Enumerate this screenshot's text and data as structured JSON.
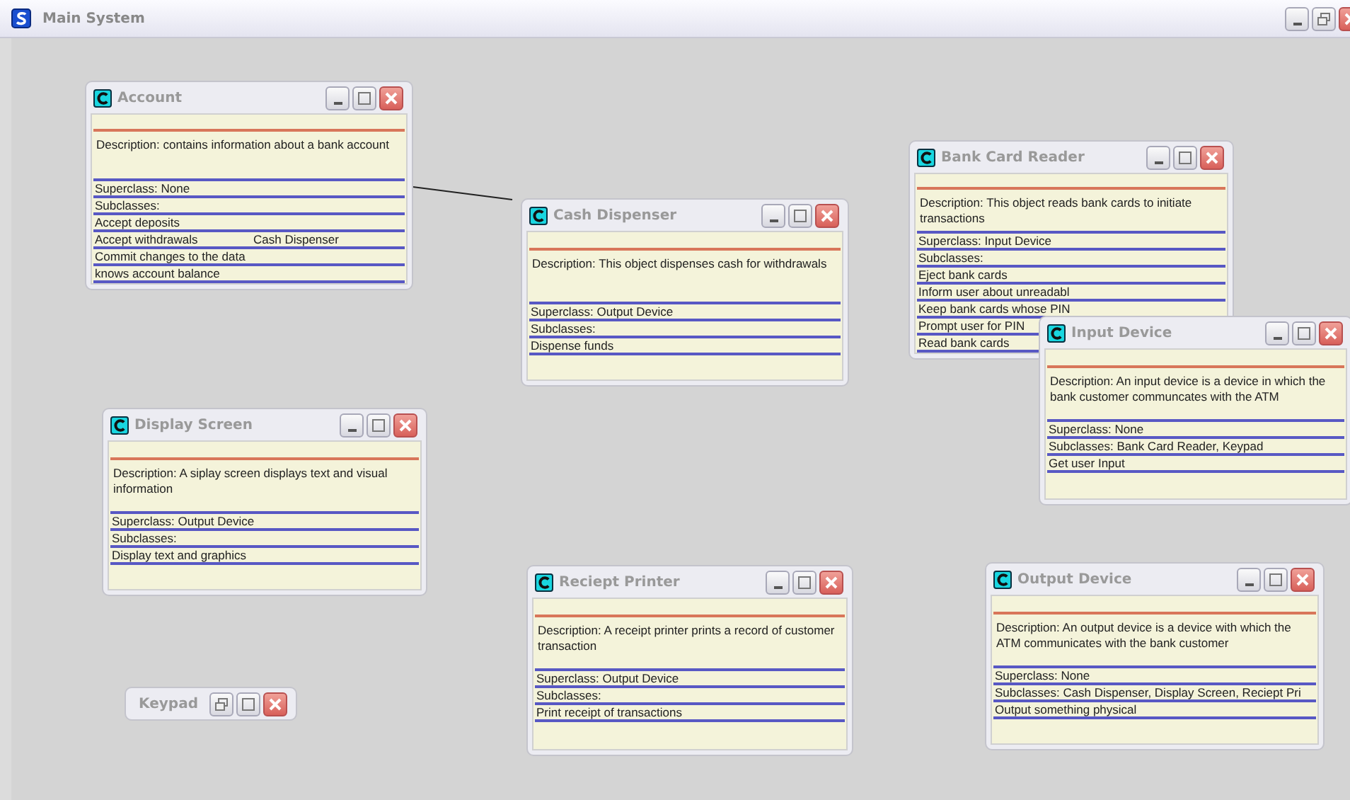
{
  "window": {
    "title": "Main System"
  },
  "cards": [
    {
      "title": "Account",
      "minimized": false,
      "description": "Description: contains information about a bank account",
      "superclass": "Superclass: None",
      "subclasses": "Subclasses:",
      "responsibilities": [
        {
          "text": "Accept deposits"
        },
        {
          "text": "Accept withdrawals",
          "collaborator": "Cash Dispenser"
        },
        {
          "text": "Commit changes to the data"
        },
        {
          "text": "knows account balance"
        }
      ]
    },
    {
      "title": "Display Screen",
      "minimized": false,
      "description": "Description: A siplay screen displays text and visual information",
      "superclass": "Superclass: Output Device",
      "subclasses": "Subclasses:",
      "responsibilities": [
        {
          "text": "Display text and graphics"
        }
      ]
    },
    {
      "title": "Keypad",
      "minimized": true
    },
    {
      "title": "Cash Dispenser",
      "minimized": false,
      "description": "Description: This object dispenses cash for withdrawals",
      "superclass": "Superclass: Output Device",
      "subclasses": "Subclasses:",
      "responsibilities": [
        {
          "text": "Dispense funds"
        }
      ]
    },
    {
      "title": "Reciept Printer",
      "minimized": false,
      "description": "Description: A receipt printer prints a record of customer transaction",
      "superclass": "Superclass: Output Device",
      "subclasses": "Subclasses:",
      "responsibilities": [
        {
          "text": "Print receipt of transactions"
        }
      ]
    },
    {
      "title": "Bank Card Reader",
      "minimized": false,
      "description": "Description: This object reads bank cards to initiate transactions",
      "superclass": "Superclass: Input Device",
      "subclasses": "Subclasses:",
      "responsibilities": [
        {
          "text": "Eject bank cards"
        },
        {
          "text": "Inform user  about unreadabl"
        },
        {
          "text": "Keep bank cards whose PIN"
        },
        {
          "text": "Prompt user for PIN"
        },
        {
          "text": "Read bank cards"
        }
      ]
    },
    {
      "title": "Input Device",
      "minimized": false,
      "description": "Description: An input device is a device in which the bank customer communcates with the ATM",
      "superclass": "Superclass: None",
      "subclasses": "Subclasses: Bank Card Reader, Keypad",
      "responsibilities": [
        {
          "text": "Get user Input"
        }
      ]
    },
    {
      "title": "Output Device",
      "minimized": false,
      "description": "Description: An output device is a device with which the ATM communicates with the bank customer",
      "superclass": "Superclass: None",
      "subclasses": "Subclasses: Cash Dispenser, Display Screen, Reciept Pri",
      "responsibilities": [
        {
          "text": "Output something physical"
        }
      ]
    }
  ],
  "connectors": [
    {
      "kind": "line"
    }
  ]
}
